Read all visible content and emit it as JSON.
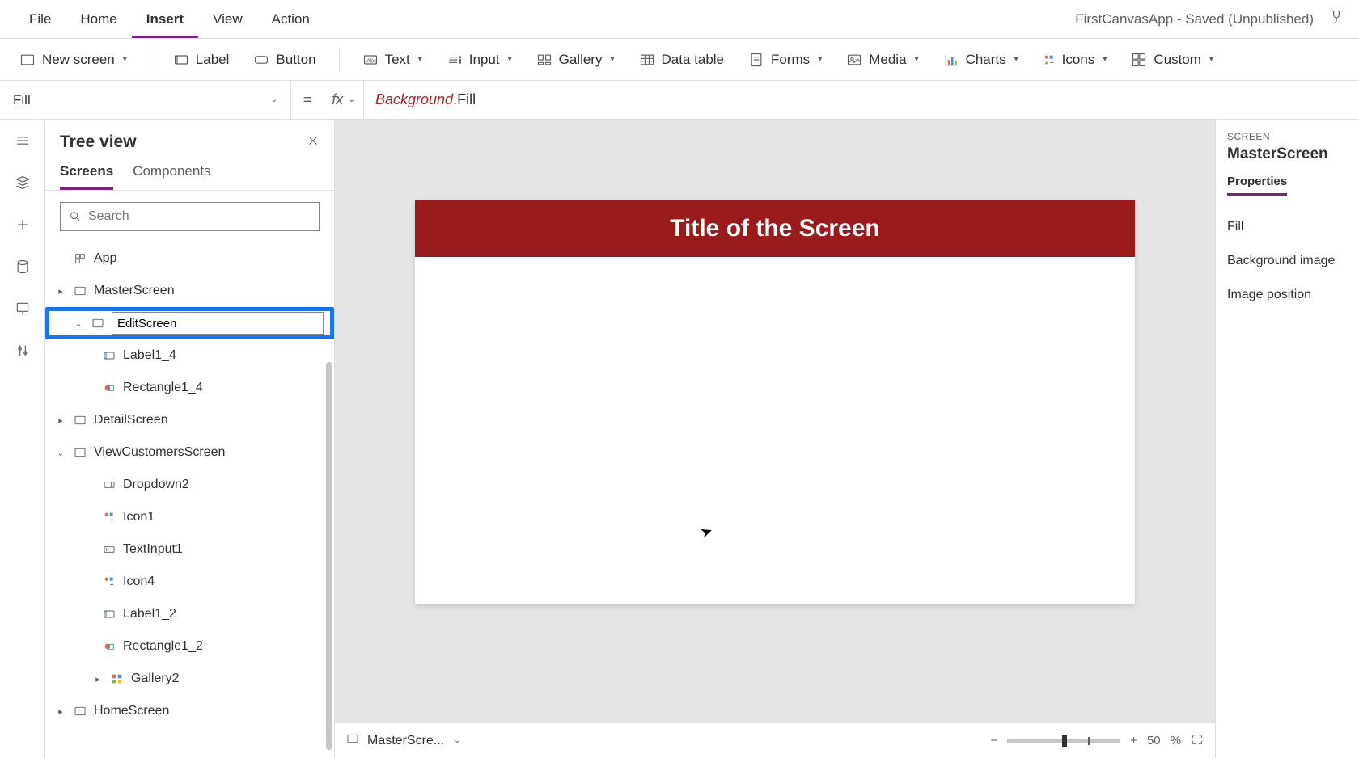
{
  "menubar": {
    "items": [
      "File",
      "Home",
      "Insert",
      "View",
      "Action"
    ],
    "active_index": 2,
    "app_title": "FirstCanvasApp - Saved (Unpublished)"
  },
  "ribbon": {
    "new_screen": "New screen",
    "label": "Label",
    "button": "Button",
    "text": "Text",
    "input": "Input",
    "gallery": "Gallery",
    "data_table": "Data table",
    "forms": "Forms",
    "media": "Media",
    "charts": "Charts",
    "icons": "Icons",
    "custom": "Custom"
  },
  "formula": {
    "property": "Fill",
    "tok1": "Background",
    "tok2": ".Fill"
  },
  "treeview": {
    "title": "Tree view",
    "tabs": {
      "screens": "Screens",
      "components": "Components",
      "active": "screens"
    },
    "search_placeholder": "Search",
    "nodes": {
      "app": "App",
      "master": "MasterScreen",
      "edit_value": "EditScreen",
      "label1_4": "Label1_4",
      "rect1_4": "Rectangle1_4",
      "detail": "DetailScreen",
      "viewcust": "ViewCustomersScreen",
      "dropdown2": "Dropdown2",
      "icon1": "Icon1",
      "textinput1": "TextInput1",
      "icon4": "Icon4",
      "label1_2": "Label1_2",
      "rect1_2": "Rectangle1_2",
      "gallery2": "Gallery2",
      "home": "HomeScreen"
    }
  },
  "canvas": {
    "screen_title": "Title of the Screen",
    "footer_selector": "MasterScre...",
    "zoom_pct": "50",
    "zoom_unit": "%"
  },
  "properties": {
    "section_label": "SCREEN",
    "selection_name": "MasterScreen",
    "tab": "Properties",
    "rows": [
      "Fill",
      "Background image",
      "Image position"
    ]
  }
}
